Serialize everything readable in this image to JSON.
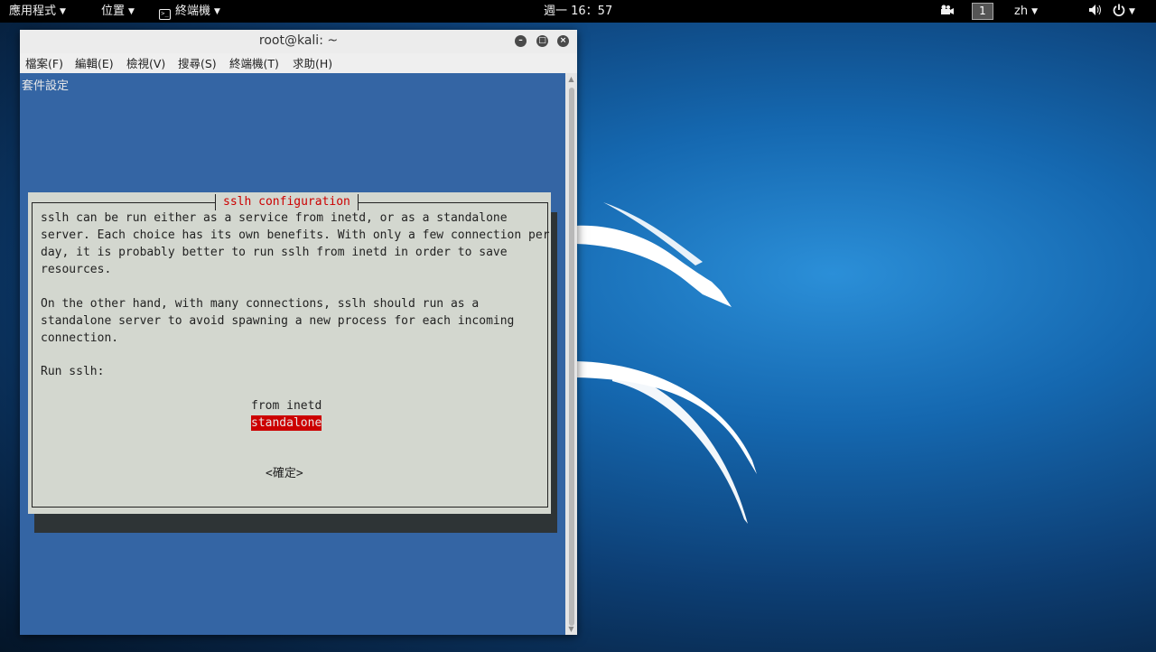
{
  "topbar": {
    "apps": "應用程式",
    "places": "位置",
    "terminal": "終端機",
    "clock": "週一 16：57",
    "workspace": "1",
    "lang": "zh",
    "volume_icon": "speaker-icon",
    "power_icon": "power-icon"
  },
  "window": {
    "title": "root@kali: ~",
    "menu": [
      "檔案(F)",
      "編輯(E)",
      "檢視(V)",
      "搜尋(S)",
      "終端機(T)",
      "求助(H)"
    ]
  },
  "terminal": {
    "header": "套件設定",
    "dialog": {
      "title": "sslh configuration",
      "lines": [
        "sslh can be run either as a service from inetd, or as a standalone",
        "server. Each choice has its own benefits. With only a few connection per",
        "day, it is probably better to run sslh from inetd in order to save",
        "resources.",
        "",
        "On the other hand, with many connections, sslh should run as a",
        "standalone server to avoid spawning a new process for each incoming",
        "connection.",
        "",
        "Run sslh:"
      ],
      "options": [
        "from inetd",
        "standalone"
      ],
      "selected_option": "standalone",
      "ok_button": "<確定>"
    }
  },
  "colors": {
    "terminal_bg": "#3465a4",
    "dialog_bg": "#d3d7cf",
    "accent_red": "#cc0000"
  }
}
